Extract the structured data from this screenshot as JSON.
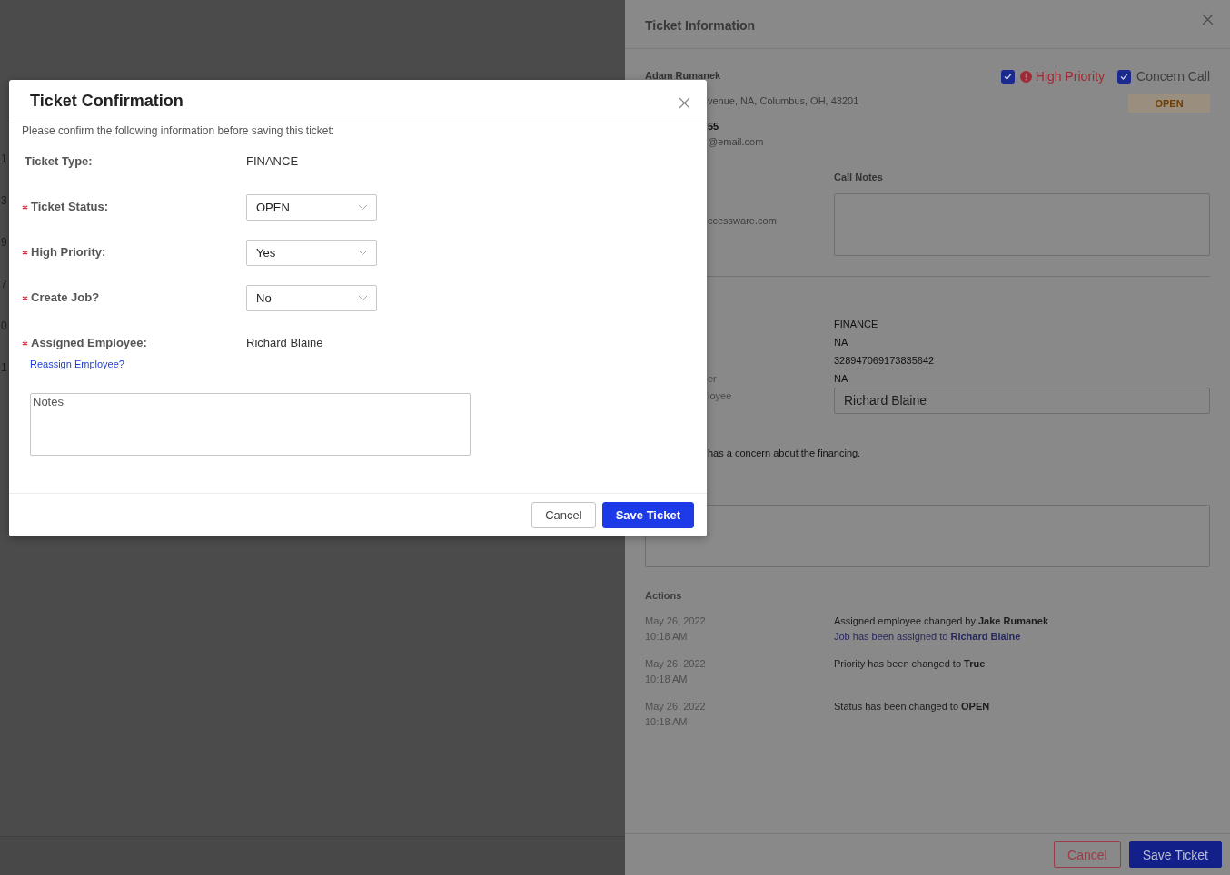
{
  "background_list": {
    "fragments": [
      "1",
      "3",
      "9",
      "7",
      "0",
      "1"
    ]
  },
  "drawer": {
    "title": "Ticket Information",
    "customer": {
      "name": "Adam Rumanek",
      "address_fragment": "venue, NA, Columbus, OH, 43201",
      "phone_fragment": "55",
      "email_fragment": "@email.com",
      "website_fragment": "ccessware.com"
    },
    "flags": [
      {
        "label": "High Priority",
        "checked": true,
        "kind": "alert"
      },
      {
        "label": "Concern Call",
        "checked": true,
        "kind": "plain"
      }
    ],
    "status_badge": "OPEN",
    "call_notes": {
      "label": "Call Notes"
    },
    "details": [
      {
        "value": "FINANCE"
      },
      {
        "value": "NA"
      },
      {
        "value": "328947069173835642"
      },
      {
        "label_fragment": "er",
        "value": "NA"
      }
    ],
    "assigned_employee": {
      "label_fragment": "loyee",
      "value": "Richard Blaine"
    },
    "concern_fragment": "has a concern about the financing.",
    "actions": {
      "title": "Actions",
      "entries": [
        {
          "date": "May 26, 2022",
          "time": "10:18 AM",
          "lines": [
            {
              "text": "Assigned employee changed by **Jake Rumanek**",
              "kind": "change"
            },
            {
              "text": "Job has been assigned to **Richard Blaine**",
              "kind": "assignment"
            }
          ]
        },
        {
          "date": "May 26, 2022",
          "time": "10:18 AM",
          "lines": [
            {
              "text": "Priority has been changed to **True**",
              "kind": "change"
            }
          ]
        },
        {
          "date": "May 26, 2022",
          "time": "10:18 AM",
          "lines": [
            {
              "text": "Status has been changed to **OPEN**",
              "kind": "change"
            }
          ]
        }
      ]
    },
    "buttons": [
      {
        "label": "Cancel",
        "kind": "secondary"
      },
      {
        "label": "Save Ticket",
        "kind": "primary"
      }
    ]
  },
  "modal": {
    "title": "Ticket Confirmation",
    "intro": "Please confirm the following information before saving this ticket:",
    "fields": [
      {
        "label": "Ticket Type:",
        "kind": "text",
        "value": "FINANCE",
        "required": false
      },
      {
        "label": "Ticket Status:",
        "kind": "select",
        "value": "OPEN",
        "required": true
      },
      {
        "label": "High Priority:",
        "kind": "select",
        "value": "Yes",
        "required": true
      },
      {
        "label": "Create Job?",
        "kind": "select",
        "value": "No",
        "required": true
      },
      {
        "label": "Assigned Employee:",
        "kind": "text",
        "value": "Richard Blaine",
        "required": true
      }
    ],
    "reassign_link": "Reassign Employee?",
    "notes": {
      "placeholder": "Notes"
    },
    "buttons": [
      {
        "label": "Cancel",
        "kind": "secondary"
      },
      {
        "label": "Save Ticket",
        "kind": "primary"
      }
    ]
  }
}
